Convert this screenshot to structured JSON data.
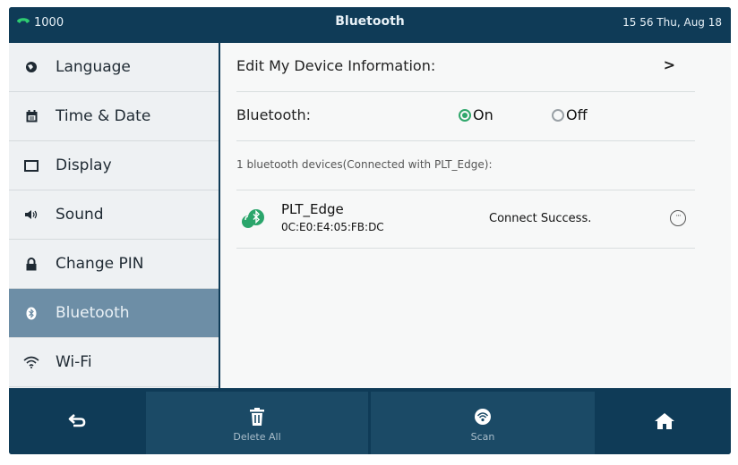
{
  "status_bar": {
    "line": "1000",
    "title": "Bluetooth",
    "clock": "15 56 Thu, Aug 18"
  },
  "sidebar": {
    "items": [
      {
        "label": "Language",
        "icon": "globe-icon"
      },
      {
        "label": "Time & Date",
        "icon": "calendar-icon"
      },
      {
        "label": "Display",
        "icon": "display-icon"
      },
      {
        "label": "Sound",
        "icon": "speaker-icon"
      },
      {
        "label": "Change PIN",
        "icon": "lock-icon"
      },
      {
        "label": "Bluetooth",
        "icon": "bluetooth-icon",
        "selected": true
      },
      {
        "label": "Wi-Fi",
        "icon": "wifi-icon"
      }
    ]
  },
  "main": {
    "edit_device_label": "Edit My Device Information:",
    "chevron": ">",
    "bluetooth_label": "Bluetooth:",
    "radio_on": "On",
    "radio_off": "Off",
    "bluetooth_state": "On",
    "summary": "1 bluetooth devices(Connected with PLT_Edge):",
    "device": {
      "name": "PLT_Edge",
      "mac": "0C:E0:E4:05:FB:DC",
      "status": "Connect Success.",
      "icon": "bluetooth-headset-icon"
    }
  },
  "softkeys": {
    "back_icon": "back-arrow-icon",
    "delete_all_label": "Delete All",
    "delete_icon": "trash-icon",
    "scan_label": "Scan",
    "scan_icon": "scan-icon",
    "home_icon": "home-icon"
  },
  "colors": {
    "chrome": "#0f3b57",
    "softkey_bg": "#1b4a66",
    "selected_item": "#6d8ea6",
    "radio_on": "#2fa76b",
    "phone_icon": "#2ecc71",
    "device_icon": "#2aa56b"
  }
}
